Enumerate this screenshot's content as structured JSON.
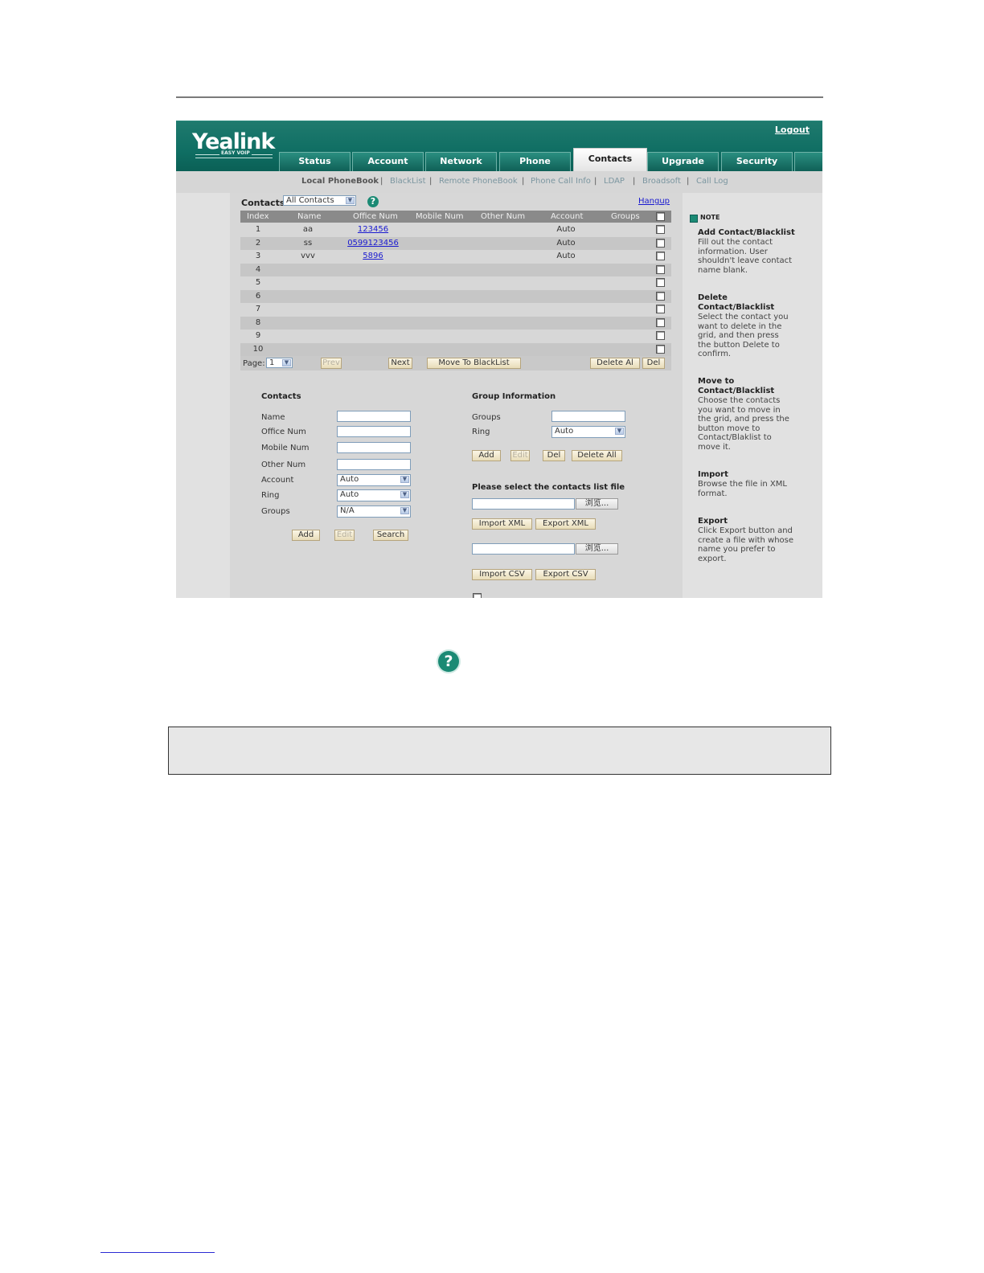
{
  "header": {
    "brand": "Yealink",
    "brand_sub": "EASY VOIP",
    "logout": "Logout",
    "tabs": [
      "Status",
      "Account",
      "Network",
      "Phone",
      "Contacts",
      "Upgrade",
      "Security"
    ],
    "active_tab": "Contacts"
  },
  "subnav": {
    "items": [
      "Local PhoneBook",
      "BlackList",
      "Remote PhoneBook",
      "Phone Call Info",
      "LDAP",
      "Broadsoft",
      "Call Log"
    ],
    "active": "Local PhoneBook"
  },
  "contacts_list": {
    "label": "Contacts",
    "filter_value": "All Contacts",
    "hangup": "Hangup",
    "columns": [
      "Index",
      "Name",
      "Office Num",
      "Mobile Num",
      "Other Num",
      "Account",
      "Groups"
    ],
    "rows": [
      {
        "index": "1",
        "name": "aa",
        "office": "123456",
        "mobile": "",
        "other": "",
        "account": "Auto",
        "groups": ""
      },
      {
        "index": "2",
        "name": "ss",
        "office": "0599123456",
        "mobile": "",
        "other": "",
        "account": "Auto",
        "groups": ""
      },
      {
        "index": "3",
        "name": "vvv",
        "office": "5896",
        "mobile": "",
        "other": "",
        "account": "Auto",
        "groups": ""
      },
      {
        "index": "4",
        "name": "",
        "office": "",
        "mobile": "",
        "other": "",
        "account": "",
        "groups": ""
      },
      {
        "index": "5",
        "name": "",
        "office": "",
        "mobile": "",
        "other": "",
        "account": "",
        "groups": ""
      },
      {
        "index": "6",
        "name": "",
        "office": "",
        "mobile": "",
        "other": "",
        "account": "",
        "groups": ""
      },
      {
        "index": "7",
        "name": "",
        "office": "",
        "mobile": "",
        "other": "",
        "account": "",
        "groups": ""
      },
      {
        "index": "8",
        "name": "",
        "office": "",
        "mobile": "",
        "other": "",
        "account": "",
        "groups": ""
      },
      {
        "index": "9",
        "name": "",
        "office": "",
        "mobile": "",
        "other": "",
        "account": "",
        "groups": ""
      },
      {
        "index": "10",
        "name": "",
        "office": "",
        "mobile": "",
        "other": "",
        "account": "",
        "groups": ""
      }
    ],
    "page_label": "Page:",
    "page_value": "1",
    "buttons": {
      "prev": "Prev",
      "next": "Next",
      "move": "Move To BlackList",
      "delete_all": "Delete Al",
      "del": "Del"
    }
  },
  "contact_form": {
    "title": "Contacts",
    "fields": {
      "name": "Name",
      "office": "Office Num",
      "mobile": "Mobile Num",
      "other": "Other Num",
      "account": "Account",
      "ring": "Ring",
      "groups": "Groups"
    },
    "account_value": "Auto",
    "ring_value": "Auto",
    "groups_value": "N/A",
    "buttons": {
      "add": "Add",
      "edit": "Edit",
      "search": "Search"
    }
  },
  "group_form": {
    "title": "Group Information",
    "groups_label": "Groups",
    "ring_label": "Ring",
    "ring_value": "Auto",
    "buttons": {
      "add": "Add",
      "edit": "Edit",
      "del": "Del",
      "delete_all": "Delete All"
    }
  },
  "import": {
    "title": "Please select the contacts list file",
    "browse": "浏览...",
    "import_xml": "Import XML",
    "export_xml": "Export XML",
    "import_csv": "Import CSV",
    "export_csv": "Export CSV"
  },
  "notes": {
    "header": "NOTE",
    "items": [
      {
        "title": "Add Contact/Blacklist",
        "text": "Fill out the contact information. User shouldn't leave contact name blank."
      },
      {
        "title": "Delete Contact/Blacklist",
        "text": "Select the contact you want to delete in the grid, and then press the button Delete to confirm."
      },
      {
        "title": "Move to Contact/Blacklist",
        "text": "Choose the contacts you want to move in the grid, and press the button move to Contact/Blaklist to move it."
      },
      {
        "title": "Import",
        "text": "Browse the file in XML format."
      },
      {
        "title": "Export",
        "text": "Click Export button and create a file with whose name you prefer to export."
      }
    ]
  },
  "colors": {
    "header_teal": "#0f6e63",
    "panel_gray": "#d7d7d7",
    "link_blue": "#1a1ad0"
  },
  "icons": {
    "help": "help-icon",
    "note": "note-icon"
  }
}
